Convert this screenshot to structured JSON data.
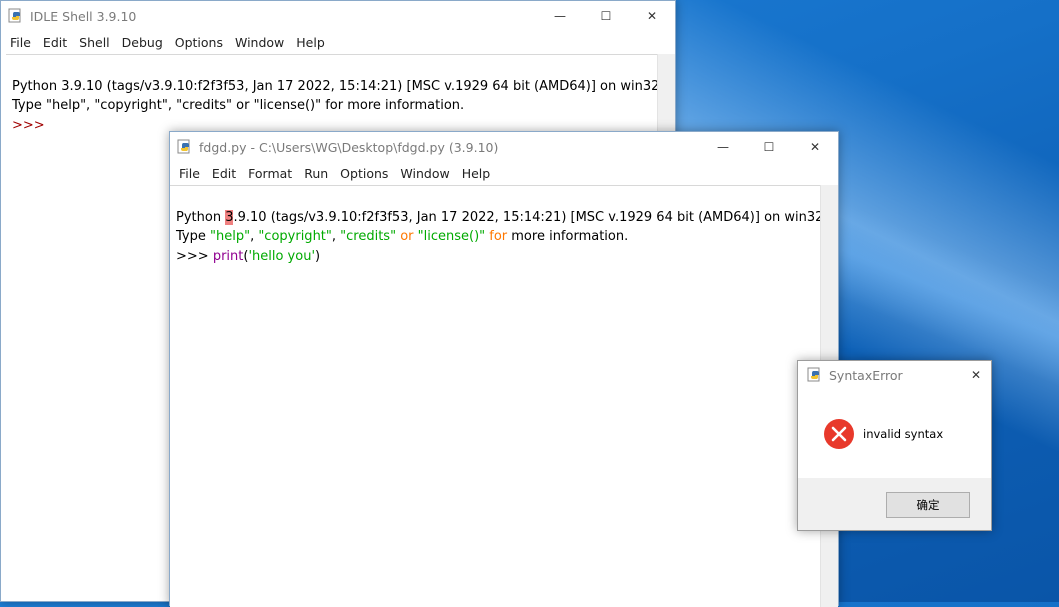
{
  "shell": {
    "title": "IDLE Shell 3.9.10",
    "menu": [
      "File",
      "Edit",
      "Shell",
      "Debug",
      "Options",
      "Window",
      "Help"
    ],
    "line1": "Python 3.9.10 (tags/v3.9.10:f2f3f53, Jan 17 2022, 15:14:21) [MSC v.1929 64 bit (AMD64)] on win32",
    "line2": "Type \"help\", \"copyright\", \"credits\" or \"license()\" for more information.",
    "prompt": ">>>"
  },
  "editor": {
    "title": "fdgd.py - C:\\Users\\WG\\Desktop\\fdgd.py (3.9.10)",
    "menu": [
      "File",
      "Edit",
      "Format",
      "Run",
      "Options",
      "Window",
      "Help"
    ],
    "line1_pre": "Python ",
    "line1_hl": "3",
    "line1_post": ".9.10 (tags/v3.9.10:f2f3f53, Jan 17 2022, 15:14:21) [MSC v.1929 64 bit (AMD64)] on win32",
    "line2_type": "Type ",
    "line2_help": "\"help\"",
    "line2_c1": ", ",
    "line2_copyright": "\"copyright\"",
    "line2_c2": ", ",
    "line2_credits": "\"credits\"",
    "line2_or": " or ",
    "line2_license": "\"license()\"",
    "line2_for": " for",
    "line2_rest": " more information.",
    "line3_prompt": ">>> ",
    "line3_fn": "print",
    "line3_open": "(",
    "line3_str": "'hello you'",
    "line3_close": ")"
  },
  "dialog": {
    "title": "SyntaxError",
    "message": "invalid syntax",
    "ok_label": "确定"
  },
  "window_controls": {
    "minimize": "—",
    "maximize": "☐",
    "close": "✕"
  },
  "colors": {
    "string": "#00aa00",
    "keyword": "#ff7700",
    "builtin": "#900090",
    "prompt": "#a00000",
    "error_highlight": "#f08080",
    "error_icon": "#e8392b"
  }
}
